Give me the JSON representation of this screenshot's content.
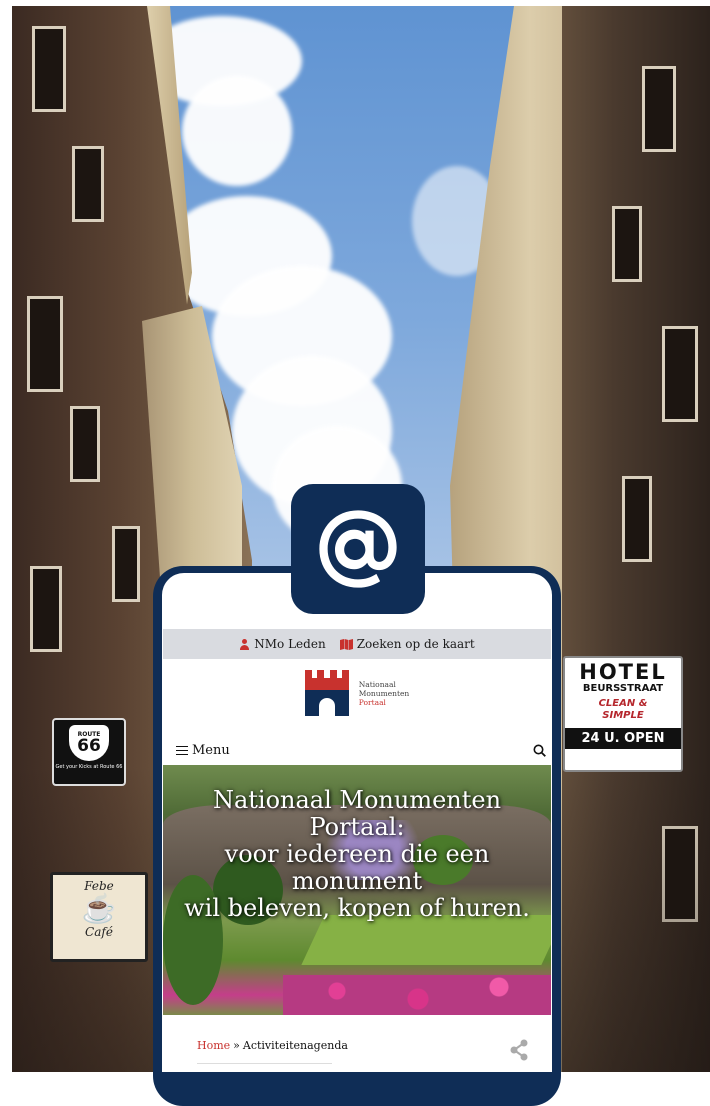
{
  "top_bar": {
    "members_label": "NMo Leden",
    "map_search_label": "Zoeken op de kaart"
  },
  "logo": {
    "line1": "Nationaal",
    "line2": "Monumenten",
    "line3": "Portaal"
  },
  "nav": {
    "menu_label": "Menu"
  },
  "hero": {
    "line1": "Nationaal Monumenten",
    "line2": "Portaal:",
    "line3": "voor iedereen die een",
    "line4": "monument",
    "line5": "wil beleven, kopen of huren."
  },
  "breadcrumb": {
    "home": "Home",
    "separator": "»",
    "current": "Activiteitenagenda"
  },
  "signs": {
    "route66_top": "ROUTE",
    "route66_num": "66",
    "route66_sub": "Get your Kicks at Route 66",
    "cafe_name": "Febe",
    "cafe_word": "Café",
    "hotel_title": "HOTEL",
    "hotel_street": "BEURSSTRAAT",
    "hotel_slogan1": "CLEAN &",
    "hotel_slogan2": "SIMPLE",
    "hotel_open": "24 U. OPEN"
  },
  "colors": {
    "brand_navy": "#0f2d56",
    "accent_red": "#c8322e",
    "topbar_gray": "#d9dbe0"
  }
}
